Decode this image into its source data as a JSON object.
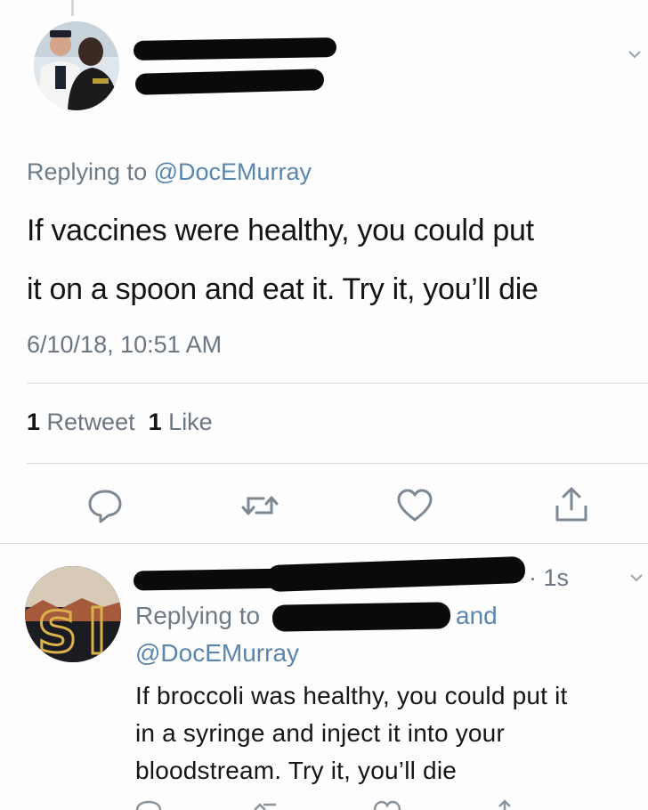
{
  "tweet1": {
    "avatar_icon": "user-photo-avatar",
    "replying_prefix": "Replying to",
    "replying_handle": "@DocEMurray",
    "text_lines": [
      "If vaccines were healthy, you could put",
      "it on a spoon and eat it. Try it, you’ll die"
    ],
    "timestamp": "6/10/18, 10:51 AM",
    "retweet_count": "1",
    "retweet_label": "Retweet",
    "like_count": "1",
    "like_label": "Like",
    "actions": [
      "reply-icon",
      "retweet-icon",
      "like-heart-icon",
      "share-icon"
    ]
  },
  "tweet2": {
    "avatar_icon": "logo-avatar",
    "time_suffix": "· 1s",
    "replying_prefix": "Replying to",
    "replying_and": "and",
    "replying_handle": "@DocEMurray",
    "text_lines": [
      "If broccoli was healthy, you could put it",
      "in a syringe and inject it into your",
      "bloodstream. Try it, you’ll die"
    ]
  },
  "colors": {
    "link": "#5a86ad",
    "muted": "#6b7680",
    "text": "#141414",
    "divider": "#d8dcdf",
    "redaction": "#0a0a0a"
  }
}
